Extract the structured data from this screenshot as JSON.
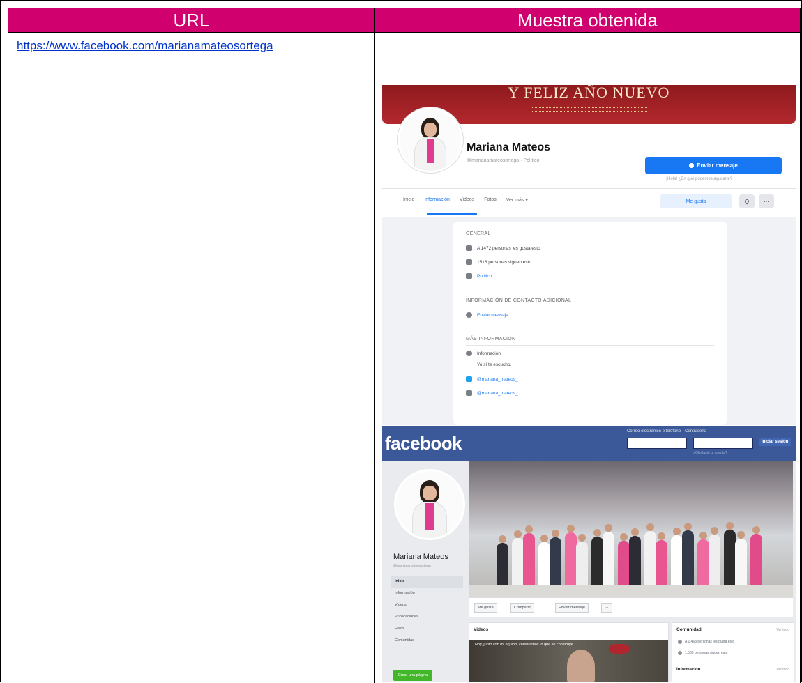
{
  "table": {
    "col_url": "URL",
    "col_sample": "Muestra obtenida",
    "url_text": "https://www.facebook.com/marianamateosortega"
  },
  "shot1": {
    "cover_text": "Y FELIZ AÑO NUEVO",
    "profile_name": "Mariana Mateos",
    "profile_meta": "@marianamateosortega · Político",
    "send_button": "Enviar mensaje",
    "send_hint": "¡Hola! ¿En qué podemos ayudarte?",
    "tabs": [
      "Inicio",
      "Información",
      "Videos",
      "Fotos",
      "Ver más ▾"
    ],
    "like_button": "Me gusta",
    "search_glyph": "Q",
    "more_glyph": "···",
    "sections": {
      "general": "GENERAL",
      "contact": "INFORMACIÓN DE CONTACTO ADICIONAL",
      "more": "MÁS INFORMACIÓN"
    },
    "general_rows": [
      "A 1472 personas les gusta esto",
      "1516 personas siguen esto",
      "Político"
    ],
    "contact_rows": [
      "Enviar mensaje"
    ],
    "more_rows": [
      "Información",
      "Yo sí te escucho.",
      "@mariana_mateos_",
      "@mariana_mateos_"
    ]
  },
  "shot2": {
    "logo": "facebook",
    "login_labels": [
      "Correo electrónico o teléfono",
      "Contraseña"
    ],
    "login_button": "Iniciar sesión",
    "forgot": "¿Olvidaste tu cuenta?",
    "profile_name": "Mariana Mateos",
    "profile_handle": "@marianamateosortega",
    "nav": [
      "Inicio",
      "Información",
      "Videos",
      "Publicaciones",
      "Fotos",
      "Comunidad"
    ],
    "create_page": "Crear una página",
    "actions": [
      "Me gusta",
      "Compartir",
      "Enviar mensaje",
      "···"
    ],
    "videos_title": "Videos",
    "video_caption": "Hoy, junto con mi equipo, celebramos lo que se construye...",
    "community_title": "Comunidad",
    "see_all": "Ver todo",
    "community_rows": [
      "A 1.463 personas les gusta esto",
      "1.509 personas siguen esto"
    ],
    "info_title": "Información",
    "info_see_all": "Ver todo"
  },
  "colors": {
    "header_magenta": "#d1006f",
    "fb_blue": "#1877f2",
    "fb_classic": "#3b5998",
    "link_blue": "#0033cc"
  }
}
